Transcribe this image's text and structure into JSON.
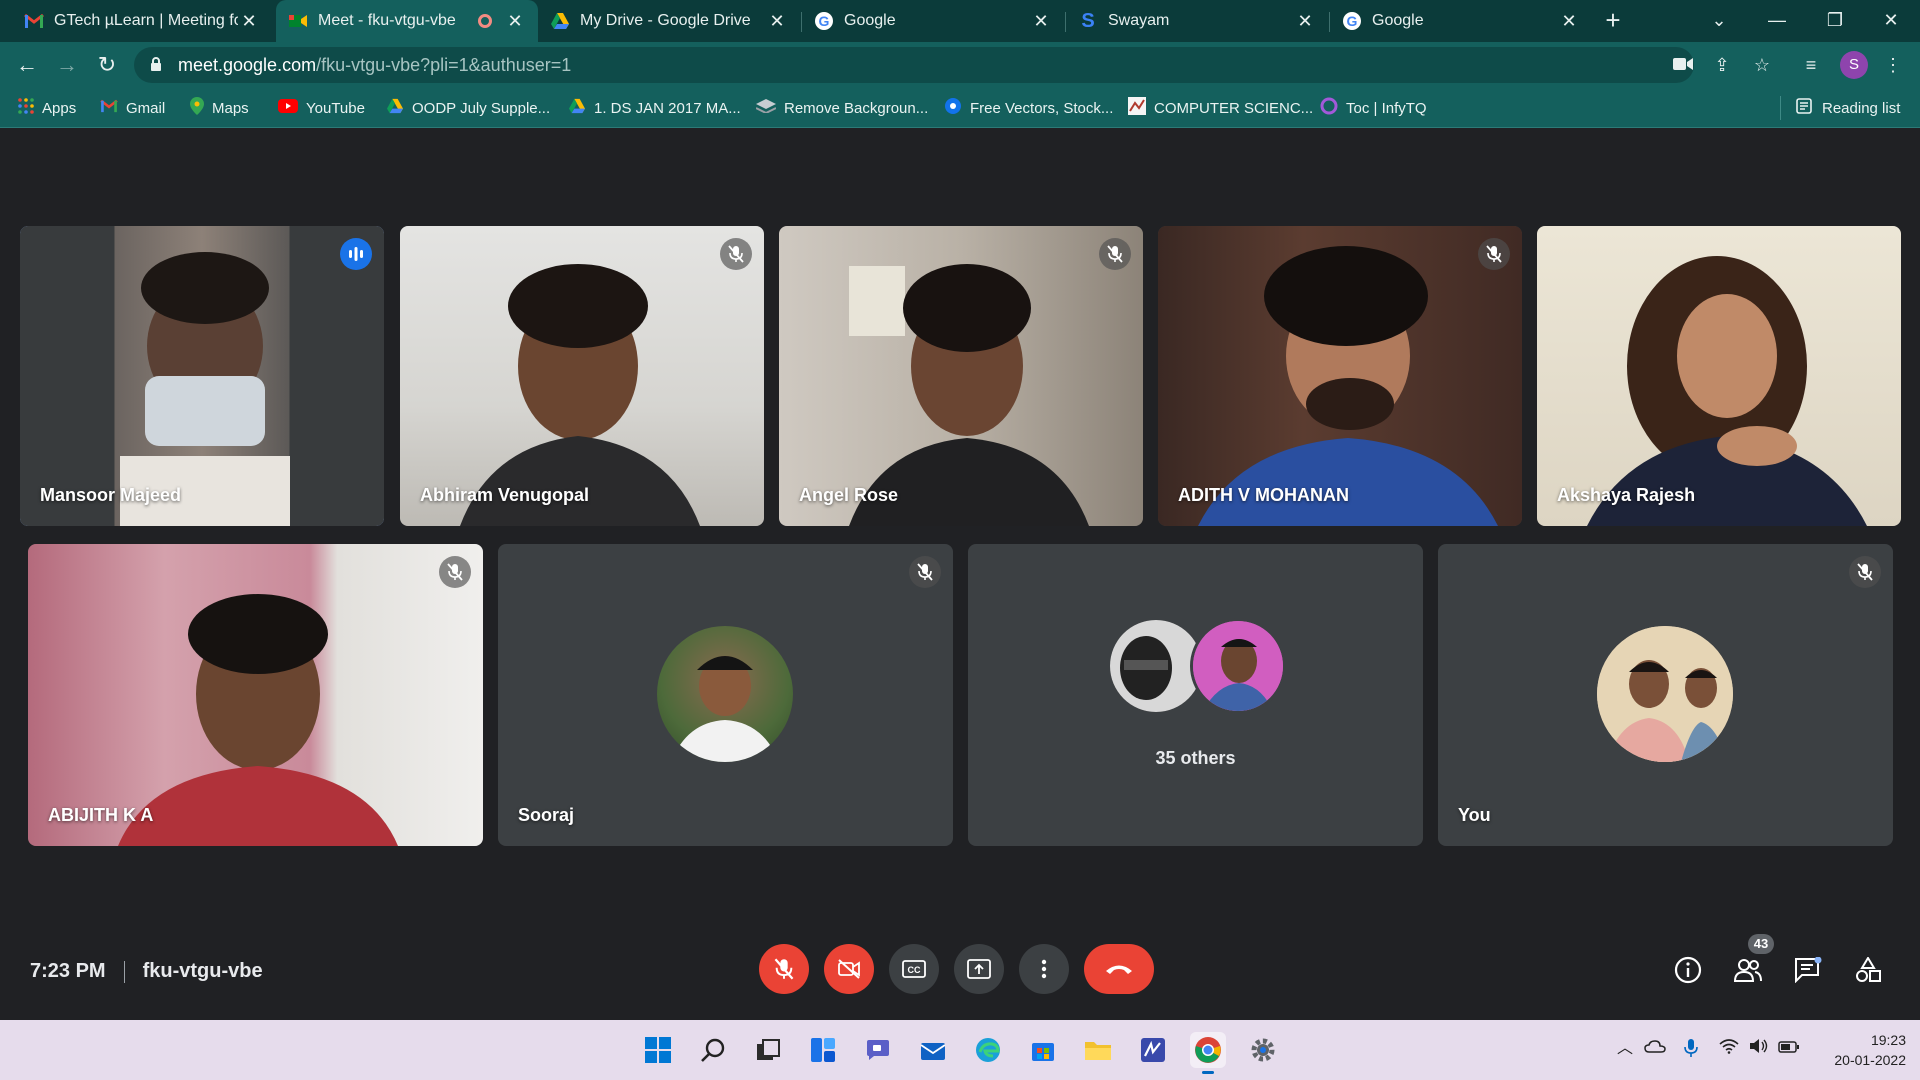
{
  "browser": {
    "tabs": [
      {
        "title": "GTech µLearn | Meeting for",
        "favicon": "gmail-icon"
      },
      {
        "title": "Meet - fku-vtgu-vbe",
        "favicon": "meet-icon",
        "active": true,
        "recording": true
      },
      {
        "title": "My Drive - Google Drive",
        "favicon": "drive-icon"
      },
      {
        "title": "Google",
        "favicon": "google-icon"
      },
      {
        "title": "Swayam",
        "favicon": "swayam-icon"
      },
      {
        "title": "Google",
        "favicon": "google-icon"
      }
    ],
    "url_main": "meet.google.com",
    "url_rest": "/fku-vtgu-vbe?pli=1&authuser=1",
    "profile_initial": "S",
    "bookmarks": [
      {
        "label": "Apps"
      },
      {
        "label": "Gmail"
      },
      {
        "label": "Maps"
      },
      {
        "label": "YouTube"
      },
      {
        "label": "OODP July Supple..."
      },
      {
        "label": "1. DS JAN 2017 MA..."
      },
      {
        "label": "Remove Backgroun..."
      },
      {
        "label": "Free Vectors, Stock..."
      },
      {
        "label": "COMPUTER SCIENC..."
      },
      {
        "label": "Toc | InfyTQ"
      }
    ],
    "reading_list": "Reading list",
    "colors": {
      "tabstrip": "#0b3b3a",
      "toolbar": "#14605d"
    }
  },
  "meet": {
    "participants_row1": [
      {
        "name": "Mansoor Majeed",
        "speaking": true
      },
      {
        "name": "Abhiram Venugopal",
        "muted": true
      },
      {
        "name": "Angel Rose",
        "muted": true
      },
      {
        "name": "ADITH V MOHANAN",
        "muted": true
      },
      {
        "name": "Akshaya Rajesh"
      }
    ],
    "participants_row2": [
      {
        "name": "ABIJITH K A",
        "muted": true
      },
      {
        "name": "Sooraj",
        "muted": true
      },
      {
        "name": "35 others"
      },
      {
        "name": "You",
        "muted": true
      }
    ],
    "time": "7:23 PM",
    "meeting_code": "fku-vtgu-vbe",
    "participant_count": "43",
    "colors": {
      "accent": "#8ab4f8",
      "danger": "#ea4335",
      "tile": "#3c4043"
    }
  },
  "taskbar": {
    "clock_time": "19:23",
    "clock_date": "20-01-2022"
  }
}
